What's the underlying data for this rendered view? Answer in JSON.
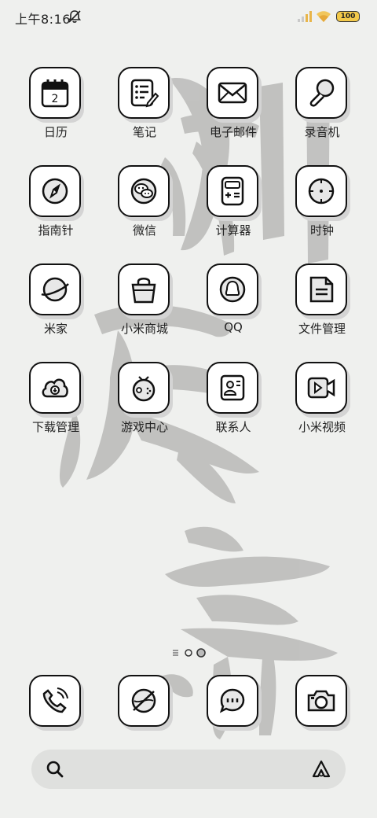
{
  "status_bar": {
    "time": "上午8:16",
    "battery": "100",
    "icons": [
      "mute-bell-icon",
      "signal-icon",
      "wifi-icon",
      "battery-icon"
    ]
  },
  "apps": [
    {
      "label": "日历",
      "icon": "calendar-icon",
      "calendar_day": "2"
    },
    {
      "label": "笔记",
      "icon": "notes-icon"
    },
    {
      "label": "电子邮件",
      "icon": "mail-icon"
    },
    {
      "label": "录音机",
      "icon": "microphone-icon"
    },
    {
      "label": "指南针",
      "icon": "compass-icon"
    },
    {
      "label": "微信",
      "icon": "wechat-icon"
    },
    {
      "label": "计算器",
      "icon": "calculator-icon"
    },
    {
      "label": "时钟",
      "icon": "clock-icon"
    },
    {
      "label": "米家",
      "icon": "planet-icon"
    },
    {
      "label": "小米商城",
      "icon": "shopping-bag-icon"
    },
    {
      "label": "QQ",
      "icon": "qq-penguin-icon"
    },
    {
      "label": "文件管理",
      "icon": "file-icon"
    },
    {
      "label": "下载管理",
      "icon": "cloud-download-icon"
    },
    {
      "label": "游戏中心",
      "icon": "game-controller-icon"
    },
    {
      "label": "联系人",
      "icon": "contact-card-icon"
    },
    {
      "label": "小米视频",
      "icon": "video-camera-icon"
    }
  ],
  "dock": [
    {
      "name": "phone",
      "icon": "phone-icon"
    },
    {
      "name": "browser",
      "icon": "browser-planet-icon"
    },
    {
      "name": "messages",
      "icon": "message-bubble-icon"
    },
    {
      "name": "camera",
      "icon": "camera-icon"
    }
  ],
  "page_indicator": {
    "pages": 2,
    "current": 2
  },
  "search": {
    "icon": "search-icon",
    "assistant_icon": "assistant-icon"
  }
}
